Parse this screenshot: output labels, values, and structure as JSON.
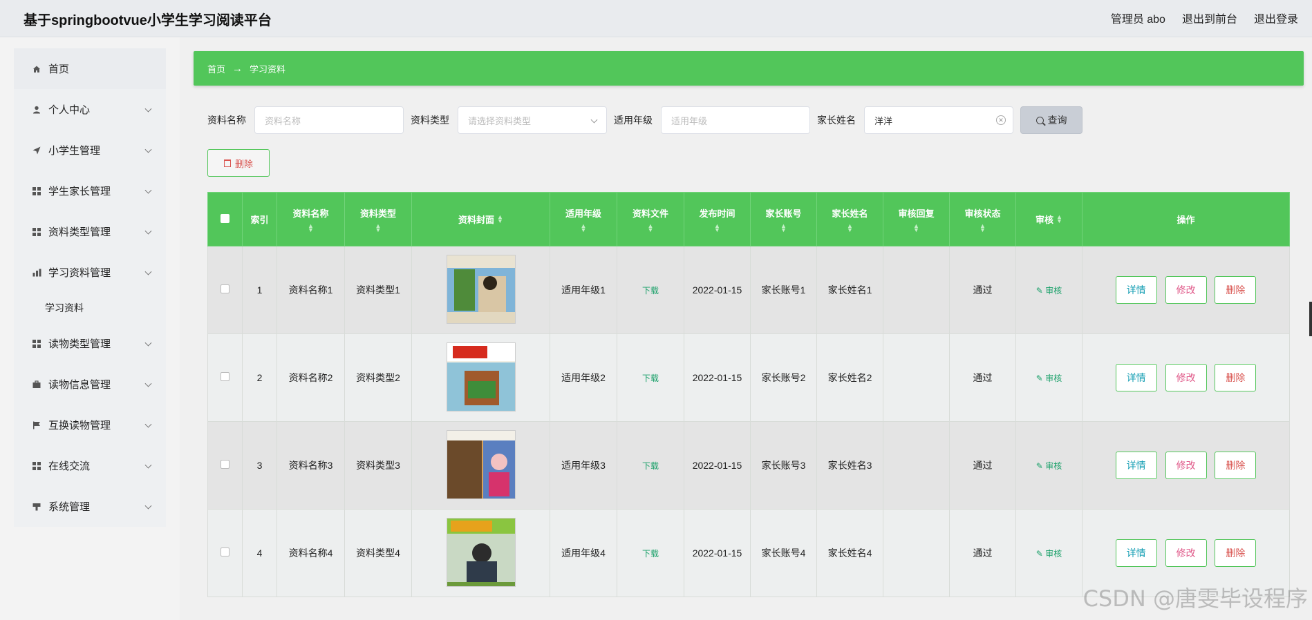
{
  "app": {
    "title": "基于springbootvue小学生学习阅读平台",
    "admin_label": "管理员 abo",
    "to_front": "退出到前台",
    "logout": "退出登录"
  },
  "sidebar": {
    "home": "首页",
    "items": [
      {
        "label": "个人中心",
        "icon": "user-icon"
      },
      {
        "label": "小学生管理",
        "icon": "send-icon"
      },
      {
        "label": "学生家长管理",
        "icon": "grid-icon"
      },
      {
        "label": "资料类型管理",
        "icon": "grid-icon"
      },
      {
        "label": "学习资料管理",
        "icon": "chart-icon",
        "submenu": [
          "学习资料"
        ]
      },
      {
        "label": "读物类型管理",
        "icon": "grid-icon"
      },
      {
        "label": "读物信息管理",
        "icon": "briefcase-icon"
      },
      {
        "label": "互换读物管理",
        "icon": "flag-icon"
      },
      {
        "label": "在线交流",
        "icon": "grid-icon"
      },
      {
        "label": "系统管理",
        "icon": "tool-icon"
      }
    ]
  },
  "breadcrumb": {
    "home": "首页",
    "arrow": "→",
    "current": "学习资料"
  },
  "filters": {
    "name_label": "资料名称",
    "name_placeholder": "资料名称",
    "type_label": "资料类型",
    "type_placeholder": "请选择资料类型",
    "grade_label": "适用年级",
    "grade_placeholder": "适用年级",
    "parent_label": "家长姓名",
    "parent_value": "洋洋",
    "search_label": "查询"
  },
  "bulk_delete": "删除",
  "table": {
    "headers": [
      "索引",
      "资料名称",
      "资料类型",
      "资料封面",
      "适用年级",
      "资料文件",
      "发布时间",
      "家长账号",
      "家长姓名",
      "审核回复",
      "审核状态",
      "审核",
      "操作"
    ],
    "rows": [
      {
        "index": "1",
        "name": "资料名称1",
        "type": "资料类型1",
        "grade": "适用年级1",
        "file": "下载",
        "time": "2022-01-15",
        "account": "家长账号1",
        "parent": "家长姓名1",
        "reply": "",
        "status": "通过",
        "audit": "审核"
      },
      {
        "index": "2",
        "name": "资料名称2",
        "type": "资料类型2",
        "grade": "适用年级2",
        "file": "下载",
        "time": "2022-01-15",
        "account": "家长账号2",
        "parent": "家长姓名2",
        "reply": "",
        "status": "通过",
        "audit": "审核"
      },
      {
        "index": "3",
        "name": "资料名称3",
        "type": "资料类型3",
        "grade": "适用年级3",
        "file": "下载",
        "time": "2022-01-15",
        "account": "家长账号3",
        "parent": "家长姓名3",
        "reply": "",
        "status": "通过",
        "audit": "审核"
      },
      {
        "index": "4",
        "name": "资料名称4",
        "type": "资料类型4",
        "grade": "适用年级4",
        "file": "下载",
        "time": "2022-01-15",
        "account": "家长账号4",
        "parent": "家长姓名4",
        "reply": "",
        "status": "通过",
        "audit": "审核"
      }
    ],
    "ops": {
      "detail": "详情",
      "edit": "修改",
      "delete": "删除"
    }
  },
  "watermark": "CSDN @唐雯毕设程序",
  "colors": {
    "accent": "#52c65a",
    "link": "#1aa069",
    "danger": "#d9534f"
  }
}
